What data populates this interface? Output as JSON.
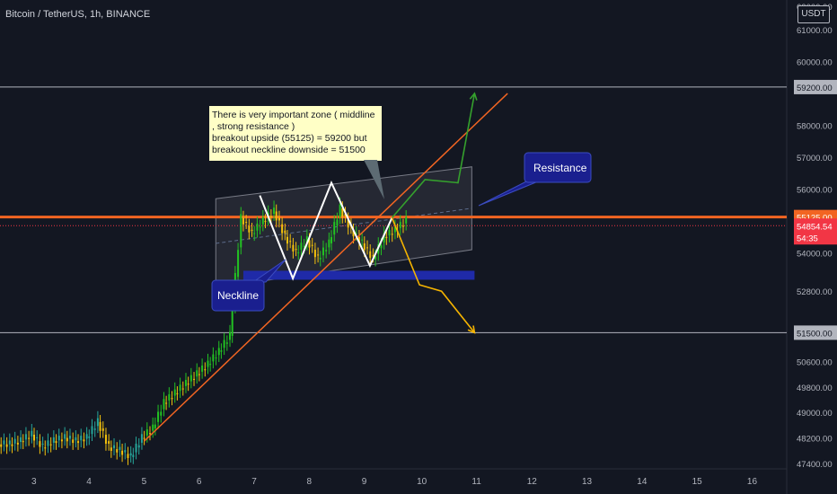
{
  "header": {
    "symbol": "Bitcoin / TetherUS, 1h, BINANCE",
    "currency": "USDT"
  },
  "colors": {
    "background": "#131722",
    "up_candle": "#26a69a",
    "up_candle_bright": "#22c322",
    "down_candle": "#f4c20d",
    "resistance_line": "#f26522",
    "trendline": "#f26522",
    "neckline": "#1f2aa8",
    "pattern_line": "#ffffff",
    "bull_path": "#35a12d",
    "bear_path": "#f5b400",
    "note_bg": "#ffffc6",
    "label_bg": "#1a1f8f"
  },
  "annotations": {
    "note": [
      "There is very important zone ( middline",
      ", strong resistance )",
      " breakout upside (55125) = 59200 but",
      " breakout neckline downside = 51500"
    ],
    "resistance_label": "Resistance",
    "neckline_label": "Neckline"
  },
  "chart_data": {
    "type": "candlestick",
    "title": "Bitcoin / TetherUS, 1h, BINANCE",
    "ylabel": "USDT",
    "ylim": [
      47000,
      62500
    ],
    "y_ticks": [
      "61000.00",
      "60000.00",
      "58000.00",
      "57000.00",
      "56000.00",
      "54000.00",
      "52800.00",
      "50600.00",
      "49800.00",
      "49000.00",
      "48200.00",
      "47400.00"
    ],
    "y_tick_values": [
      61000,
      60000,
      58000,
      57000,
      56000,
      54000,
      52800,
      50600,
      49800,
      49000,
      48200,
      47400
    ],
    "x_tick_labels": [
      "3",
      "4",
      "5",
      "6",
      "7",
      "8",
      "9",
      "10",
      "11",
      "12",
      "13",
      "14",
      "15",
      "16"
    ],
    "x_tick_values": [
      3,
      4,
      5,
      6,
      7,
      8,
      9,
      10,
      11,
      12,
      13,
      14,
      15,
      16
    ],
    "xlim": [
      2.4,
      17.5
    ],
    "price_labels": [
      {
        "value": 59200,
        "text": "59200.00"
      },
      {
        "value": 55125,
        "text": "55125.00"
      },
      {
        "value": 54854.54,
        "text": "54854.54"
      },
      {
        "value": 51500,
        "text": "51500.00"
      }
    ],
    "countdown": "54:35",
    "horizontal_levels": [
      59200,
      55125,
      51500
    ],
    "candles_approx": {
      "x": [
        2.4,
        2.6,
        2.8,
        3.0,
        3.2,
        3.4,
        3.6,
        3.8,
        4.0,
        4.2,
        4.4,
        4.6,
        4.8,
        5.0,
        5.2,
        5.4,
        5.6,
        5.8,
        6.0,
        6.2,
        6.4,
        6.6,
        6.8,
        7.0,
        7.2,
        7.4,
        7.6,
        7.8,
        8.0,
        8.2,
        8.4,
        8.6,
        8.8,
        9.0,
        9.2,
        9.4,
        9.6
      ],
      "close": [
        48000,
        48100,
        48300,
        47900,
        48100,
        48200,
        48100,
        48200,
        48700,
        47900,
        47800,
        47600,
        48200,
        48500,
        49300,
        49600,
        49900,
        50200,
        50500,
        50900,
        51400,
        55100,
        54600,
        55000,
        55300,
        54500,
        54000,
        54400,
        53800,
        54300,
        55400,
        54700,
        54300,
        53800,
        54500,
        54700,
        55000
      ]
    },
    "pattern_points": {
      "x": [
        7.1,
        7.7,
        8.4,
        9.1,
        9.5
      ],
      "y": [
        55800,
        53200,
        56200,
        53600,
        55100
      ]
    },
    "channel": {
      "x_start": 6.3,
      "x_end": 10.95,
      "upper": [
        55700,
        56700
      ],
      "lower": [
        52900,
        54100
      ]
    },
    "neckline_y": 53300,
    "neckline_x": [
      6.8,
      11.0
    ],
    "trendline": {
      "x": [
        5.0,
        11.6
      ],
      "y": [
        48100,
        59000
      ]
    },
    "bull_projection": {
      "x": [
        9.5,
        10.1,
        10.7,
        11.0
      ],
      "y": [
        55100,
        56300,
        56200,
        59000
      ]
    },
    "bear_projection": {
      "x": [
        9.5,
        10.0,
        10.4,
        11.0
      ],
      "y": [
        55100,
        53000,
        52800,
        51500
      ]
    },
    "grid": false
  }
}
